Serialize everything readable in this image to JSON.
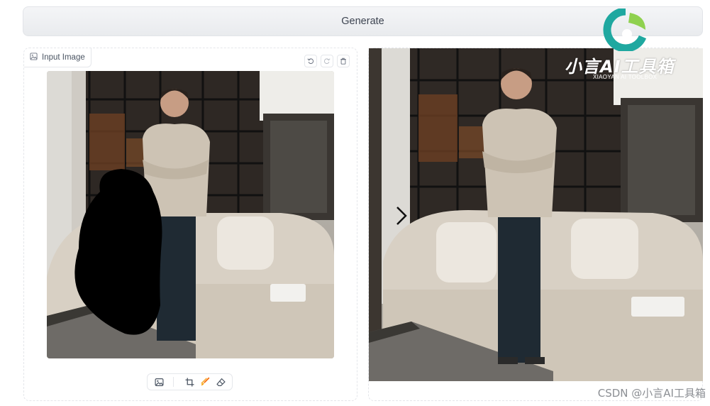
{
  "generate_button": {
    "label": "Generate"
  },
  "input_image": {
    "label": "Input Image",
    "actions": [
      "undo-icon",
      "redo-icon",
      "trash-icon"
    ]
  },
  "edit_toolbar": {
    "tools": [
      "image-icon",
      "crop-icon",
      "brush-icon",
      "eraser-icon"
    ]
  },
  "output_image": {
    "nav": "chevron-right-icon"
  },
  "logo": {
    "title": "小言AI工具箱",
    "subtitle": "XIAOYAN AI TOOLBOX",
    "colors": {
      "primary": "#1fa8a0",
      "secondary": "#8fd14f"
    }
  },
  "watermark": {
    "text": "CSDN @小言AI工具箱"
  },
  "colors": {
    "accent": "#f97316",
    "border": "#e5e7eb",
    "button_bg": "#eef0f3"
  }
}
